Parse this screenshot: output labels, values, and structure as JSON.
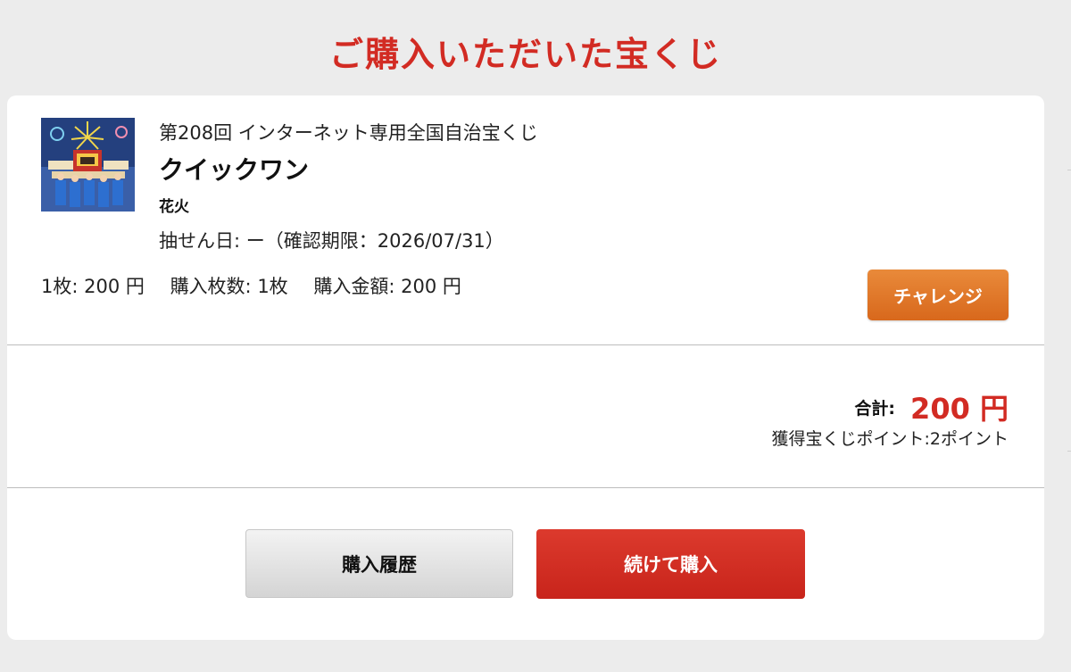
{
  "page": {
    "title": "ご購入いただいた宝くじ"
  },
  "ticket": {
    "image_alt": "fireworks-festival-thumbnail",
    "series": "第208回 インターネット専用全国自治宝くじ",
    "name": "クイックワン",
    "variant": "花火",
    "draw_date": "抽せん日: ー（確認期限：2026/07/31）",
    "unit_price": "1枚: 200 円",
    "quantity": "購入枚数: 1枚",
    "amount": "購入金額: 200 円",
    "challenge_label": "チャレンジ"
  },
  "summary": {
    "total_label": "合計:",
    "total_value": "200 円",
    "points": "獲得宝くじポイント:2ポイント"
  },
  "actions": {
    "history_label": "購入履歴",
    "continue_label": "続けて購入"
  },
  "colors": {
    "accent_red": "#d22b23",
    "challenge_orange": "#e07526",
    "background": "#ececec"
  }
}
